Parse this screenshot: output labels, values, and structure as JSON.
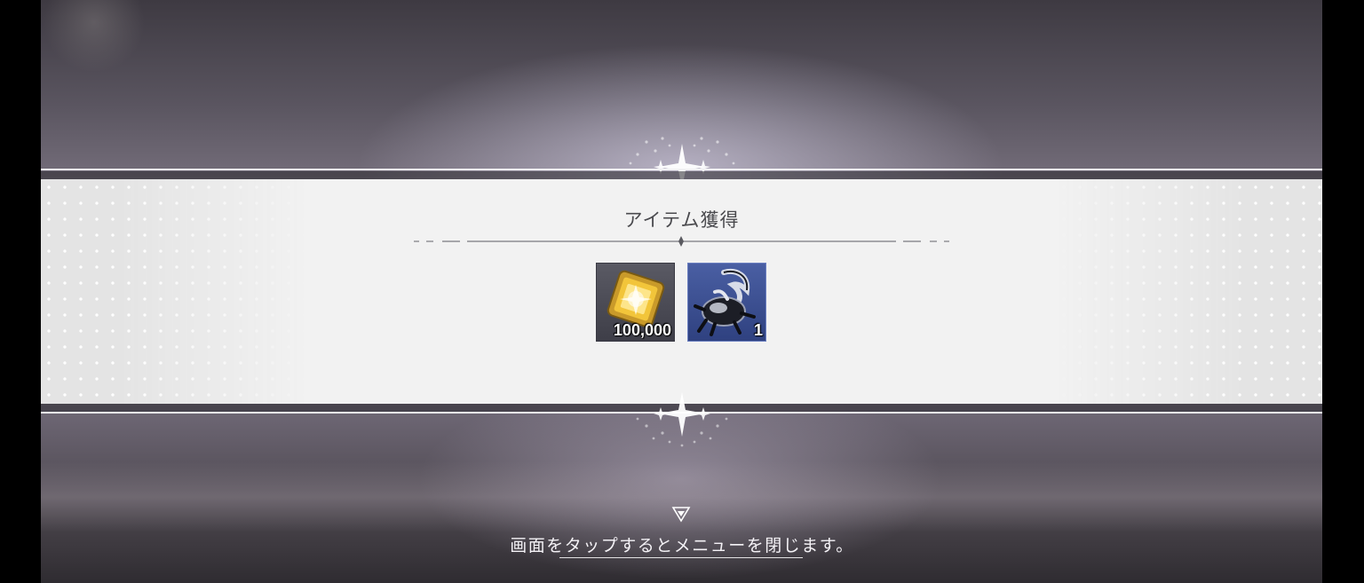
{
  "dialog": {
    "title": "アイテム獲得",
    "items": [
      {
        "icon": "gold-crystal-icon",
        "quantity": "100,000",
        "frame_color": "#44444e"
      },
      {
        "icon": "beetle-icon",
        "quantity": "1",
        "frame_color": "#3a4f95"
      }
    ]
  },
  "footer": {
    "close_hint": "画面をタップするとメニューを閉じます。",
    "arrow_icon": "down-triangle-icon"
  },
  "colors": {
    "banner": "#f2f2f2",
    "title_text": "#4a4a4e",
    "hint_text": "#f4f2f6"
  }
}
